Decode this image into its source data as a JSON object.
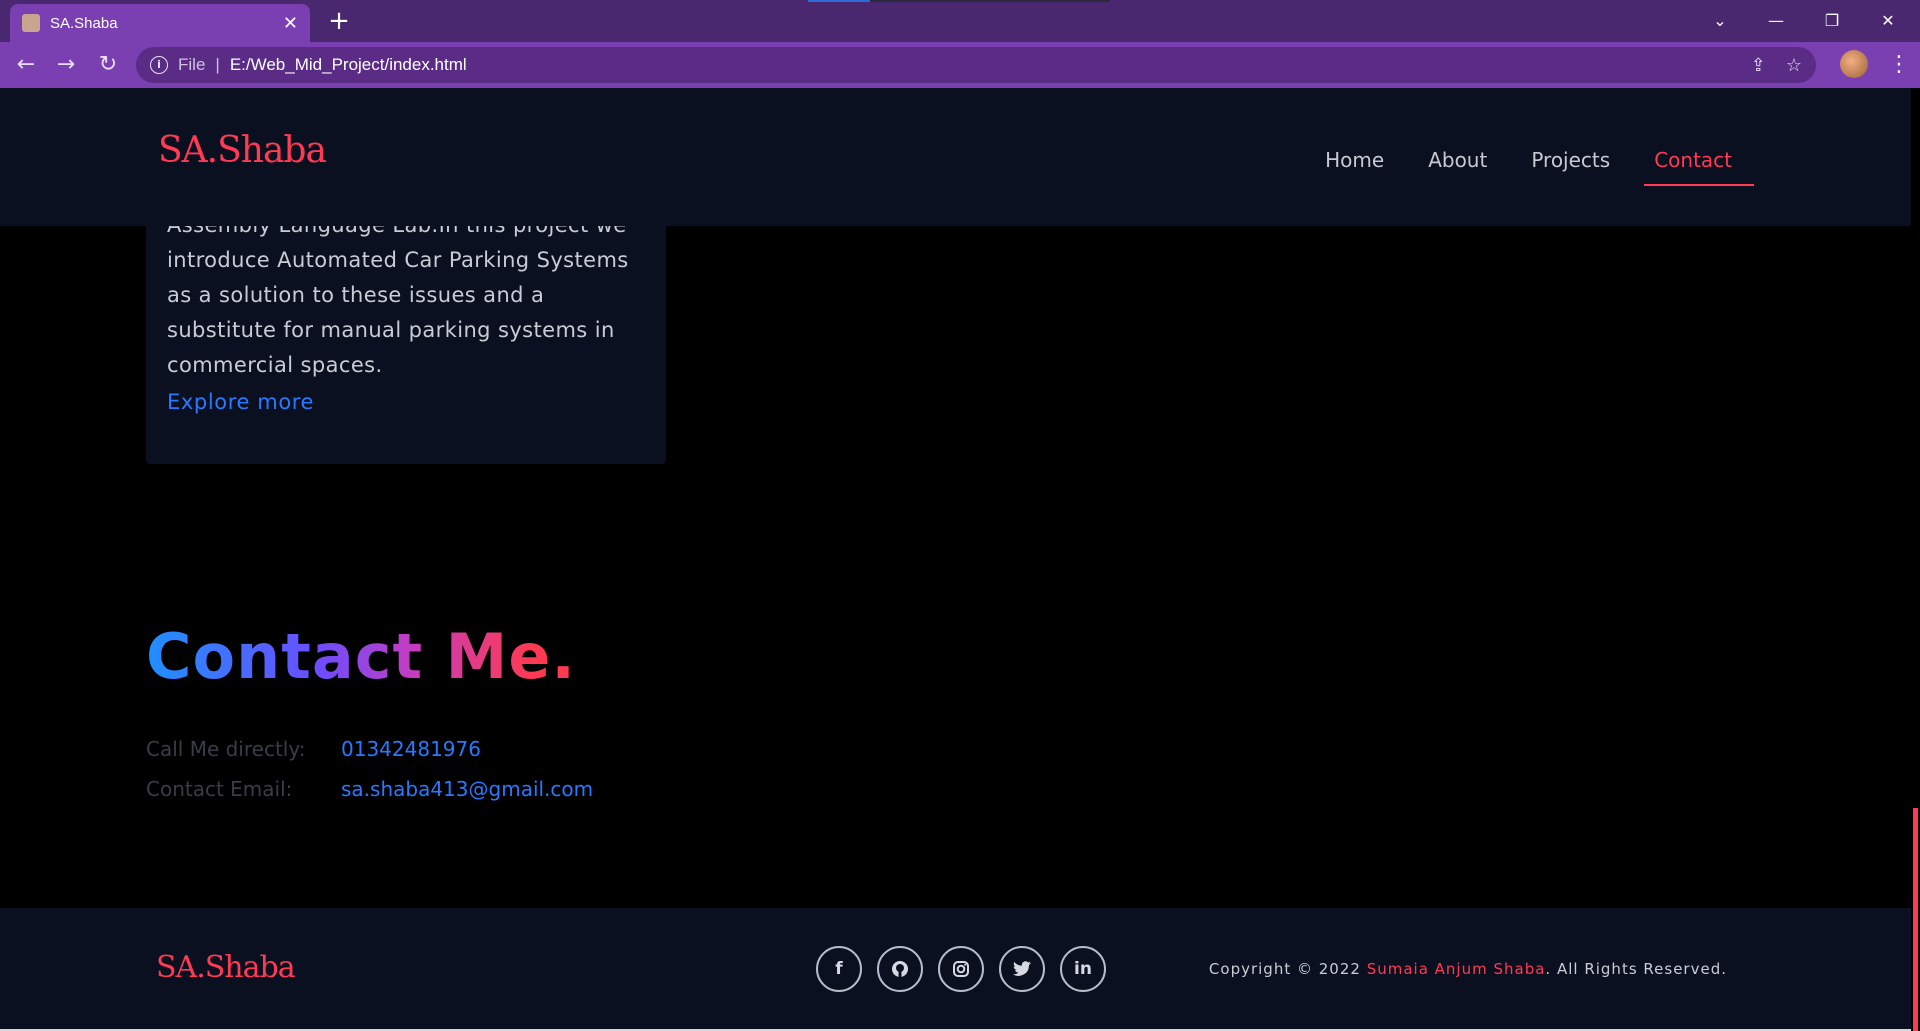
{
  "browser": {
    "tab_title": "SA.Shaba",
    "url_scheme": "File",
    "url": "E:/Web_Mid_Project/index.html"
  },
  "header": {
    "logo": "SA.Shaba",
    "nav": [
      "Home",
      "About",
      "Projects",
      "Contact"
    ],
    "active_nav": "Contact"
  },
  "project_card": {
    "description": "Assembly Language Lab.In this project we introduce Automated Car Parking Systems as a solution to these issues and a substitute for manual parking systems in commercial spaces.",
    "link_label": "Explore more"
  },
  "contact": {
    "title": "Contact Me.",
    "phone_label": "Call Me directly:",
    "phone": "01342481976",
    "email_label": "Contact Email:",
    "email": "sa.shaba413@gmail.com"
  },
  "footer": {
    "logo": "SA.Shaba",
    "socials": [
      "facebook",
      "github",
      "instagram",
      "twitter",
      "linkedin"
    ],
    "copyright_prefix": "Copyright © 2022 ",
    "copyright_name": "Sumaia Anjum Shaba",
    "copyright_suffix": ". All Rights Reserved."
  },
  "colors": {
    "accent": "#ff3a52",
    "link": "#2979ff",
    "header_bg": "#0b1020",
    "browser_purple": "#7a3fb0"
  }
}
